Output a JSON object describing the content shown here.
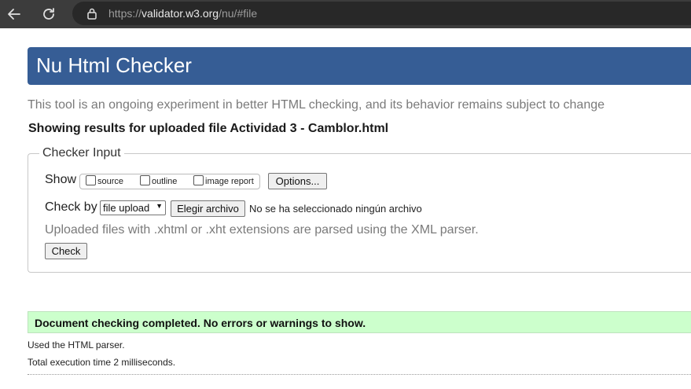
{
  "browser": {
    "url_scheme": "https://",
    "url_host": "validator.w3.org",
    "url_path": "/nu/#file"
  },
  "header": {
    "title": "Nu Html Checker"
  },
  "tagline": "This tool is an ongoing experiment in better HTML checking, and its behavior remains subject to change",
  "results_heading": "Showing results for uploaded file Actividad 3 - Camblor.html",
  "checker_input": {
    "legend": "Checker Input",
    "show_label": "Show",
    "show_options": [
      {
        "label": "source",
        "checked": false
      },
      {
        "label": "outline",
        "checked": false
      },
      {
        "label": "image report",
        "checked": false
      }
    ],
    "options_button": "Options...",
    "check_by_label": "Check by",
    "check_by_value": "file upload",
    "choose_file_button": "Elegir archivo",
    "no_file_text": "No se ha seleccionado ningún archivo",
    "parser_note": "Uploaded files with .xhtml or .xht extensions are parsed using the XML parser.",
    "check_button": "Check"
  },
  "status": {
    "success_message": "Document checking completed. No errors or warnings to show.",
    "success_color": "#ccffcc",
    "parser_used": "Used the HTML parser.",
    "execution_time": "Total execution time 2 milliseconds."
  },
  "colors": {
    "banner": "#365d95"
  }
}
